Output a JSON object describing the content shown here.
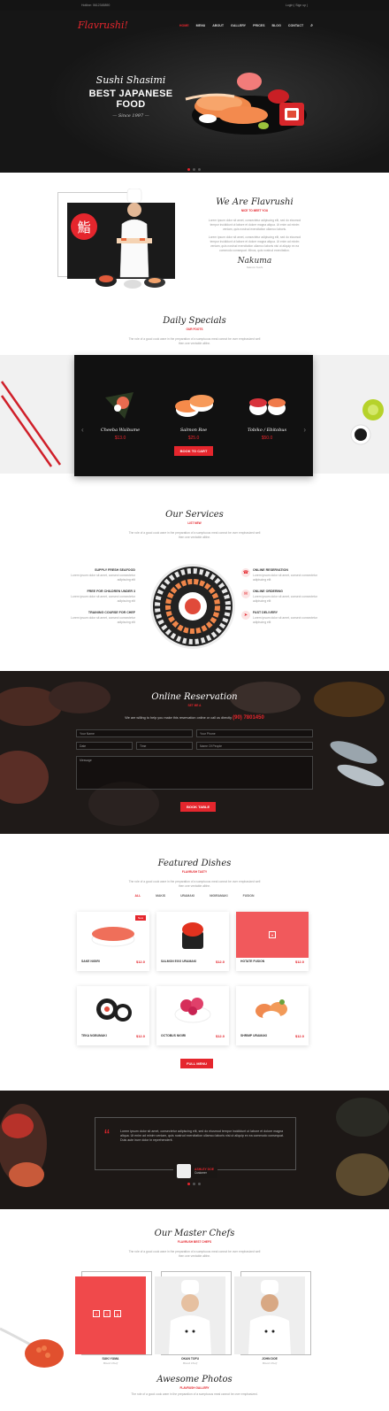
{
  "topbar": {
    "address": "Hotline: 0612345890",
    "account": "Login | Sign up |"
  },
  "nav": {
    "logo": "Flavrushi!",
    "items": [
      "HOME",
      "MENU",
      "ABOUT",
      "GALLERY",
      "PRICES",
      "BLOG",
      "CONTACT"
    ]
  },
  "hero": {
    "line1": "Sushi Shasimi",
    "line2": "BEST JAPANESE FOOD",
    "line3": "— Since 1997 —"
  },
  "about": {
    "kanji": "鮨",
    "title": "We Are Flavrushi",
    "subtitle": "NICE TO MEET YOU",
    "para1": "Lorem ipsum dolor sit amet, consectetur adipiscing elit, sed do eiusmod tempor incididunt ut labore et dolore magna aliqua. Ut enim ad minim veniam, quis nostrud exercitation ullamco laboris.",
    "para2": "Lorem ipsum dolor sit amet, consectetur adipiscing elit, sed do eiusmod tempor incididunt ut labore et dolore magna aliqua. Ut enim ad minim veniam, quis nostrud exercitation ullamco laboris nisi ut aliquip ex ea commodo consequat. Minus, quis nostrud exercitation.",
    "signature": "Nakuma",
    "signer": "Nakumi Sushi"
  },
  "specials": {
    "title": "Daily Specials",
    "subtitle": "OUR FOOTS",
    "para": "The role of a good cook ware in the preparation of a sumptuous meal cannot be over emphasized well then one ventable albhe.",
    "dishes": [
      {
        "name": "Cheeba Waibume",
        "price": "$13.0"
      },
      {
        "name": "Salmon Roe",
        "price": "$25.0"
      },
      {
        "name": "Tobiko / Ebitobus",
        "price": "$50.0"
      }
    ],
    "button": "BOOK TO CART"
  },
  "services": {
    "title": "Our Services",
    "subtitle": "LIST NEW",
    "para": "The role of a good cook ware in the preparation of a sumptuous meal cannot be over emphasized well then one ventable albhe.",
    "items": [
      {
        "title": "SUPPLY FRESH SEAFOOD",
        "desc": "Lorem ipsum dolor sit amet, consect consectetur adipiscing elit"
      },
      {
        "title": "FREE FOR CHILDREN UNDER 3",
        "desc": "Lorem ipsum dolor sit amet, consect consectetur adipiscing elit"
      },
      {
        "title": "TRAINING COURSE FOR CHEF",
        "desc": "Lorem ipsum dolor sit amet, consect consectetur adipiscing elit"
      },
      {
        "title": "ONLINE RESERVATION",
        "desc": "Lorem ipsum dolor sit amet, consect consectetur adipiscing elit"
      },
      {
        "title": "ONLINE ORDERING",
        "desc": "Lorem ipsum dolor sit amet, consect consectetur adipiscing elit"
      },
      {
        "title": "FAST DELIVERY",
        "desc": "Lorem ipsum dolor sit amet, consect consectetur adipiscing elit"
      }
    ]
  },
  "reservation": {
    "title": "Online Reservation",
    "subtitle": "SET ME A",
    "call": "We are willing to help you make this reservation online or call us directly",
    "phone": "(90) 7801450",
    "fields": {
      "name": "Your Name",
      "phone": "Your Phone",
      "date": "Date",
      "time": "Time",
      "people": "Name Of People",
      "message": "Message"
    },
    "button": "BOOK TABLE"
  },
  "featured": {
    "title": "Featured Dishes",
    "subtitle": "FLAVRUSH TASTY",
    "para": "The role of a good cook ware in the preparation of a sumptuous meal cannot be over emphasized well then one ventable albhe.",
    "tabs": [
      "ALL",
      "MAKIS",
      "URAMAKI",
      "NIGIRAMAKI",
      "FUSION"
    ],
    "badge": "New",
    "cards": [
      {
        "name": "SAKE NIGIRI",
        "price": "$12.0"
      },
      {
        "name": "SALMON EGG URAMAKI",
        "price": "$12.0"
      },
      {
        "name": "HOTATE FUSION",
        "price": "$12.0"
      },
      {
        "name": "TEKA NOBUMAKI",
        "price": "$12.0"
      },
      {
        "name": "OCTOBUS NIGIRI",
        "price": "$12.0"
      },
      {
        "name": "SHRIMP URAMAKI",
        "price": "$12.0"
      }
    ],
    "button": "FULL MENU"
  },
  "testimonial": {
    "text": "Lorem ipsum dolor sit amet, consectetur adipiscing elit, sed do eiusmod tempor incididunt ut labore et dolore magna aliqua. Ut enim ad minim veniam, quis nostrud exercitation ullamco laboris nisi ut aliquip ex ea commodo consequat. Duis aute irure dolor in reprehenderit.",
    "name": "ASHLEY DOE",
    "role": "Customer"
  },
  "chefs": {
    "title": "Our Master Chefs",
    "subtitle": "FLAVRUSH BEST CHEFS",
    "para": "The role of a good cook ware in the preparation of a sumptuous meal cannot be over emphasized well then one ventable albhe.",
    "list": [
      {
        "name": "SUKI YUMA",
        "role": "Head Chef"
      },
      {
        "name": "OKAN TOFU",
        "role": "Head Chef"
      },
      {
        "name": "JOHN DOE",
        "role": "Head Chef"
      }
    ]
  },
  "photos": {
    "title": "Awesome Photos",
    "subtitle": "FLAVRUSH GALLERY",
    "para": "The role of a good cook ware in the preparation of a sumptuous meal cannot be over emphasized."
  },
  "colors": {
    "accent": "#e5262d",
    "dark": "#1c1c1c"
  }
}
